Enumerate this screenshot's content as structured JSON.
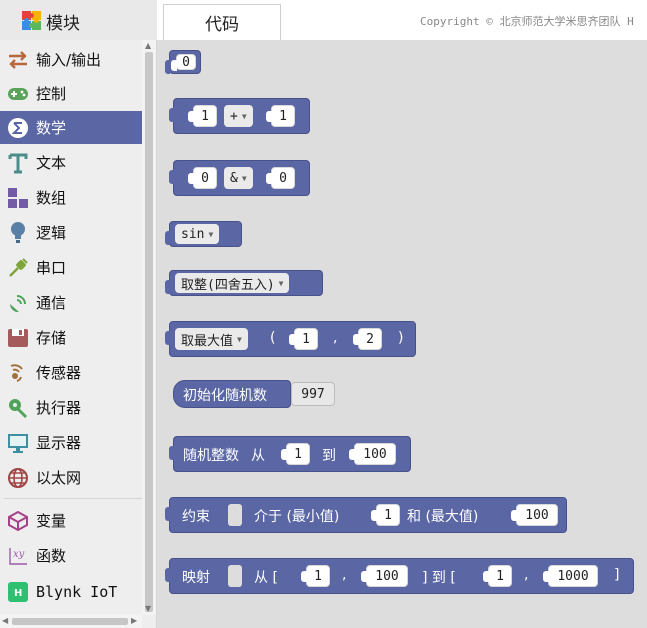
{
  "toolbox": {
    "title": "模块",
    "categories": [
      {
        "label": "输入/输出",
        "icon": "swap-arrows-icon",
        "color": "#b8683c"
      },
      {
        "label": "控制",
        "icon": "gamepad-icon",
        "color": "#5aa35a"
      },
      {
        "label": "数学",
        "icon": "math-sigma-icon",
        "color": "#5b67a5",
        "selected": true
      },
      {
        "label": "文本",
        "icon": "text-t-icon",
        "color": "#4a8d8b"
      },
      {
        "label": "数组",
        "icon": "array-blocks-icon",
        "color": "#745ba5"
      },
      {
        "label": "逻辑",
        "icon": "lightbulb-icon",
        "color": "#5b80a5"
      },
      {
        "label": "串口",
        "icon": "serial-plug-icon",
        "color": "#7ea53a"
      },
      {
        "label": "通信",
        "icon": "antenna-icon",
        "color": "#4fa35a"
      },
      {
        "label": "存储",
        "icon": "storage-icon",
        "color": "#a55b5b"
      },
      {
        "label": "传感器",
        "icon": "sensor-icon",
        "color": "#a0703c"
      },
      {
        "label": "执行器",
        "icon": "actuator-icon",
        "color": "#4fa35a"
      },
      {
        "label": "显示器",
        "icon": "monitor-icon",
        "color": "#3f8fa0"
      },
      {
        "label": "以太网",
        "icon": "globe-icon",
        "color": "#a04545"
      },
      {
        "label": "变量",
        "icon": "variable-icon",
        "color": "#a5428a"
      },
      {
        "label": "函数",
        "icon": "function-icon",
        "color": "#9a5ca6"
      },
      {
        "label": "Blynk IoT",
        "icon": "blynk-icon",
        "color": "#2ebf70"
      }
    ]
  },
  "tabs": {
    "code_label": "代码",
    "copyright": "Copyright © 北京师范大学米思齐团队 H"
  },
  "blocks": {
    "number": {
      "value": "0"
    },
    "arith": {
      "left": "1",
      "op": "+",
      "right": "1"
    },
    "bitwise": {
      "left": "0",
      "op": "&",
      "right": "0"
    },
    "trig": {
      "func": "sin"
    },
    "round": {
      "func": "取整(四舍五入)"
    },
    "max": {
      "func": "取最大值",
      "open": "(",
      "a": "1",
      "comma": ",",
      "b": "2",
      "close": ")"
    },
    "seed": {
      "label": "初始化随机数",
      "value": "997"
    },
    "randint": {
      "label": "随机整数",
      "from": "从",
      "a": "1",
      "to": "到",
      "b": "100"
    },
    "constrain": {
      "label": "约束",
      "between": "介于 (最小值)",
      "min": "1",
      "and": "和 (最大值)",
      "max": "100"
    },
    "map": {
      "label": "映射",
      "from": "从 [",
      "a": "1",
      "comma1": ",",
      "b": "100",
      "to": "] 到 [",
      "c": "1",
      "comma2": ",",
      "d": "1000",
      "close": "]"
    }
  }
}
